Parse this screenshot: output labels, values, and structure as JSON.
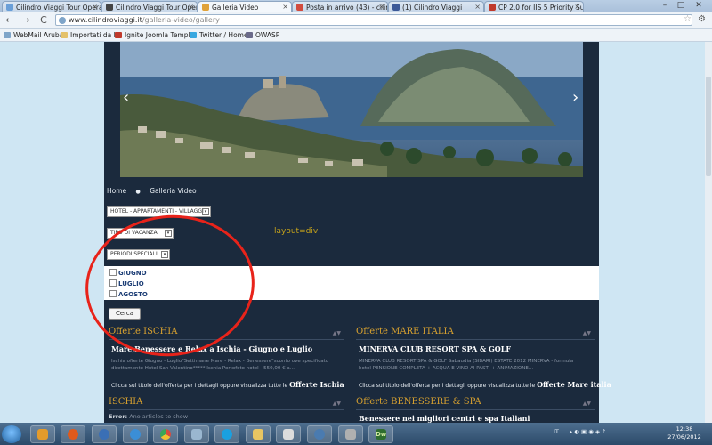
{
  "tabs": [
    {
      "title": "Cilindro Viaggi Tour Operat",
      "icon_color": "#6a9fd8"
    },
    {
      "title": "Cilindro Viaggi Tour Operat",
      "icon_color": "#444444"
    },
    {
      "title": "Galleria Video",
      "icon_color": "#e0a23a",
      "active": true
    },
    {
      "title": "Posta in arrivo (43) - cilindr",
      "icon_color": "#d24b3e"
    },
    {
      "title": "(1) Cilindro Viaggi",
      "icon_color": "#3b5998"
    },
    {
      "title": "CP 2.0 for IIS 5 Priority Supp",
      "icon_color": "#c0392b"
    }
  ],
  "window_controls": {
    "minimize": "–",
    "maximize": "□",
    "close": "✕"
  },
  "toolbar": {
    "back": "←",
    "forward": "→",
    "reload": "C",
    "star": "☆",
    "wrench": "⚙"
  },
  "address": {
    "domain": "www.cilindroviaggi.it",
    "path": "/galleria-video/gallery"
  },
  "bookmarks": [
    {
      "label": "WebMail Aruba",
      "color": "#7fa5c9"
    },
    {
      "label": "Importati da IE",
      "color": "#e4c16a"
    },
    {
      "label": "Ignite Joomla Templ...",
      "color": "#c0392b"
    },
    {
      "label": "Twitter / Home",
      "color": "#39a8e0"
    },
    {
      "label": "OWASP",
      "color": "#6a6a8a"
    }
  ],
  "breadcrumb": {
    "home": "Home",
    "separator": "●",
    "current": "Galleria Video"
  },
  "filters": {
    "hotel": "HOTEL - APPARTAMENTI - VILLAGGI",
    "tipo": "TIPO DI VACANZA",
    "periodi": "PERIODI SPECIALI",
    "caret": "▾"
  },
  "layout_note": "layout=div",
  "months": [
    "GIUGNO",
    "LUGLIO",
    "AGOSTO"
  ],
  "cerca_label": "Cerca",
  "sections": {
    "ischia": {
      "heading": "Offerte ISCHIA",
      "title": "Mare,Benessere e Relax a Ischia - Giugno e Luglio",
      "text": "Ischia offerte Giugno - Luglio\"Settimane Mare - Relax - Benessere\"sconto ove specificato direttamente Hotel San Valentino***** Ischia Portofoto hotel - 550,00 € a...",
      "link_prefix": "Clicca sul titolo dell'offerta per i dettagli oppure visualizza tutte le",
      "link_strong": "Offerte Ischia"
    },
    "mare": {
      "heading": "Offerte MARE ITALIA",
      "title": "MINERVA CLUB RESORT SPA & GOLF",
      "text": "MINERVA CLUB RESORT SPA & GOLF Sabaudia (SIBARI) ESTATE 2012 MINERVA - formula hotel PENSIONE COMPLETA + ACQUA E VINO AI PASTI + ANIMAZIONE...",
      "link_prefix": "Clicca sul titolo dell'offerta per i dettagli oppure visualizza tutte le",
      "link_strong": "Offerte Mare italia"
    },
    "ischia2": {
      "heading": "ISCHIA",
      "error_label": "Error:",
      "error_text": "Ano articles to show"
    },
    "benessere": {
      "heading": "Offerte BENESSERE & SPA",
      "title": "Benessere nei migliori centri e spa Italiani"
    },
    "toggle": "▲▼"
  },
  "taskbar": {
    "apps": [
      {
        "name": "explorer",
        "color": "#e49b2b"
      },
      {
        "name": "firefox",
        "color": "#e05a1c"
      },
      {
        "name": "thunderbird",
        "color": "#3a6fb5"
      },
      {
        "name": "internet-explorer",
        "color": "#3b8ed6"
      },
      {
        "name": "chrome",
        "color": "#d94c3d"
      },
      {
        "name": "window",
        "color": "#9ab7d0"
      },
      {
        "name": "skype",
        "color": "#1aa0e0"
      },
      {
        "name": "folder",
        "color": "#e8c562"
      },
      {
        "name": "calculator",
        "color": "#dcdcdc"
      },
      {
        "name": "app-globe",
        "color": "#4a7bb0"
      },
      {
        "name": "tools",
        "color": "#b0b0b0"
      },
      {
        "name": "dreamweaver",
        "color": "#2e6d2e",
        "label": "Dw"
      }
    ],
    "tray_lang": "IT",
    "clock_time": "12:38",
    "clock_date": "27/06/2012"
  },
  "annotation_color": "#e8231a"
}
